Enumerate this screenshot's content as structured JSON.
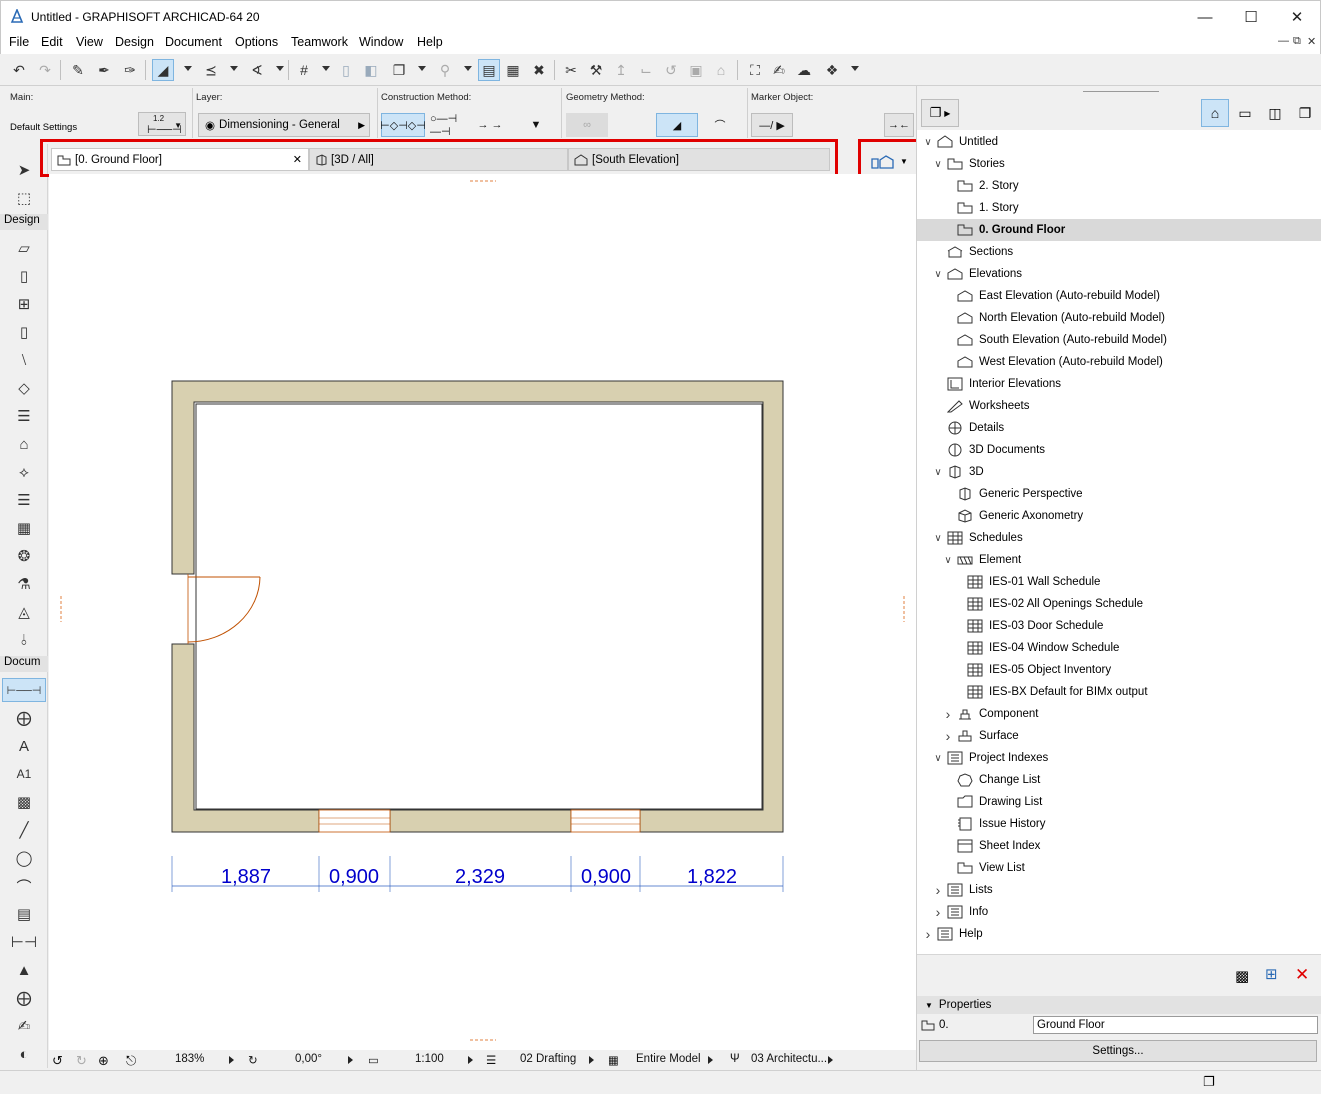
{
  "window": {
    "title": "Untitled - GRAPHISOFT ARCHICAD-64 20"
  },
  "menu": [
    "File",
    "Edit",
    "View",
    "Design",
    "Document",
    "Options",
    "Teamwork",
    "Window",
    "Help"
  ],
  "infobox": {
    "main_label": "Main:",
    "main_value": "Default Settings",
    "layer_label": "Layer:",
    "layer_value": "Dimensioning - General",
    "construction_label": "Construction Method:",
    "geometry_label": "Geometry Method:",
    "marker_label": "Marker Object:",
    "dim_badge": "1.2"
  },
  "toolbox": {
    "design_label": "Design",
    "document_label": "Docum",
    "text_tool_glyph": "A",
    "label_tool_glyph": "A1"
  },
  "tabs": [
    {
      "label": "[0. Ground Floor]",
      "active": true
    },
    {
      "label": "[3D / All]",
      "active": false
    },
    {
      "label": "[South Elevation]",
      "active": false
    }
  ],
  "drawing": {
    "dimensions": [
      "1,887",
      "0,900",
      "2,329",
      "0,900",
      "1,822"
    ]
  },
  "status": {
    "zoom": "183%",
    "angle": "0,00°",
    "scale": "1:100",
    "pen_set": "02 Drafting",
    "model_view": "Entire Model",
    "renovation": "03 Architectu..."
  },
  "navigator": {
    "items": [
      {
        "label": "Untitled",
        "level": 0,
        "chev": "down",
        "icon": "project-icon"
      },
      {
        "label": "Stories",
        "level": 1,
        "chev": "down",
        "icon": "story-icon"
      },
      {
        "label": "2. Story",
        "level": 2,
        "chev": "",
        "icon": "story-icon"
      },
      {
        "label": "1. Story",
        "level": 2,
        "chev": "",
        "icon": "story-icon"
      },
      {
        "label": "0. Ground Floor",
        "level": 2,
        "chev": "",
        "icon": "story-icon",
        "selected": true
      },
      {
        "label": "Sections",
        "level": 1,
        "chev": "",
        "icon": "section-icon"
      },
      {
        "label": "Elevations",
        "level": 1,
        "chev": "down",
        "icon": "elevation-icon"
      },
      {
        "label": "East Elevation (Auto-rebuild Model)",
        "level": 2,
        "chev": "",
        "icon": "elevation-icon"
      },
      {
        "label": "North Elevation (Auto-rebuild Model)",
        "level": 2,
        "chev": "",
        "icon": "elevation-icon"
      },
      {
        "label": "South Elevation (Auto-rebuild Model)",
        "level": 2,
        "chev": "",
        "icon": "elevation-icon"
      },
      {
        "label": "West Elevation (Auto-rebuild Model)",
        "level": 2,
        "chev": "",
        "icon": "elevation-icon"
      },
      {
        "label": "Interior Elevations",
        "level": 1,
        "chev": "",
        "icon": "interior-elevation-icon"
      },
      {
        "label": "Worksheets",
        "level": 1,
        "chev": "",
        "icon": "worksheet-icon"
      },
      {
        "label": "Details",
        "level": 1,
        "chev": "",
        "icon": "detail-icon"
      },
      {
        "label": "3D Documents",
        "level": 1,
        "chev": "",
        "icon": "3d-document-icon"
      },
      {
        "label": "3D",
        "level": 1,
        "chev": "down",
        "icon": "3d-icon"
      },
      {
        "label": "Generic Perspective",
        "level": 2,
        "chev": "",
        "icon": "perspective-icon"
      },
      {
        "label": "Generic Axonometry",
        "level": 2,
        "chev": "",
        "icon": "axonometry-icon"
      },
      {
        "label": "Schedules",
        "level": 1,
        "chev": "down",
        "icon": "schedule-icon"
      },
      {
        "label": "Element",
        "level": 2,
        "chev": "down",
        "icon": "element-icon"
      },
      {
        "label": "IES-01 Wall Schedule",
        "level": 3,
        "chev": "",
        "icon": "schedule-icon"
      },
      {
        "label": "IES-02 All Openings Schedule",
        "level": 3,
        "chev": "",
        "icon": "schedule-icon"
      },
      {
        "label": "IES-03 Door Schedule",
        "level": 3,
        "chev": "",
        "icon": "schedule-icon"
      },
      {
        "label": "IES-04 Window Schedule",
        "level": 3,
        "chev": "",
        "icon": "schedule-icon"
      },
      {
        "label": "IES-05 Object Inventory",
        "level": 3,
        "chev": "",
        "icon": "schedule-icon"
      },
      {
        "label": "IES-BX Default for BIMx output",
        "level": 3,
        "chev": "",
        "icon": "schedule-icon"
      },
      {
        "label": "Component",
        "level": 2,
        "chev": "right",
        "icon": "component-icon"
      },
      {
        "label": "Surface",
        "level": 2,
        "chev": "right",
        "icon": "surface-icon"
      },
      {
        "label": "Project Indexes",
        "level": 1,
        "chev": "down",
        "icon": "index-icon"
      },
      {
        "label": "Change List",
        "level": 2,
        "chev": "",
        "icon": "change-list-icon"
      },
      {
        "label": "Drawing List",
        "level": 2,
        "chev": "",
        "icon": "drawing-list-icon"
      },
      {
        "label": "Issue History",
        "level": 2,
        "chev": "",
        "icon": "issue-history-icon"
      },
      {
        "label": "Sheet Index",
        "level": 2,
        "chev": "",
        "icon": "sheet-index-icon"
      },
      {
        "label": "View List",
        "level": 2,
        "chev": "",
        "icon": "view-list-icon"
      },
      {
        "label": "Lists",
        "level": 1,
        "chev": "right",
        "icon": "list-icon"
      },
      {
        "label": "Info",
        "level": 1,
        "chev": "right",
        "icon": "info-icon"
      },
      {
        "label": "Help",
        "level": 0,
        "chev": "right",
        "icon": "help-icon"
      }
    ]
  },
  "properties": {
    "header": "Properties",
    "id_value": "0.",
    "name_value": "Ground Floor",
    "settings_button": "Settings..."
  },
  "colors": {
    "wall_fill": "#d8d0b0",
    "dimension_text": "#0000cc",
    "highlight": "#e00000",
    "selection": "#cce4f7"
  }
}
